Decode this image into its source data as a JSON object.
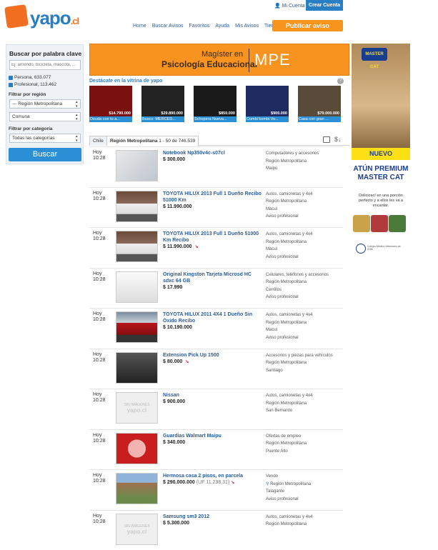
{
  "header": {
    "logo_text": "yapo",
    "logo_tld": ".cl",
    "mi_cuenta": "Mi Cuenta",
    "crear_cuenta": "Crear Cuenta",
    "nav": [
      "Home",
      "Buscar Avisos",
      "Favoritos",
      "Ayuda",
      "Mis Avisos",
      "Tiendas"
    ],
    "publicar": "Publicar aviso"
  },
  "sidebar": {
    "title": "Buscar por palabra clave",
    "search_placeholder": "Ej: arriendo, bicicleta, mascota, ...",
    "persona": "Persona, 633.077",
    "profesional": "Profesional, 113.462",
    "region_label": "Filtrar por región",
    "region_value": "--- Región Metropolitana",
    "comuna_value": "Comuna",
    "categoria_label": "Filtrar por categoría",
    "categoria_value": "Todas las categorías",
    "buscar": "Buscar"
  },
  "banner": {
    "line1": "Magíster en",
    "line2": "Psicología Educacional",
    "brand": "MPE"
  },
  "vitrina": {
    "title": "Destácate en la vitrina de yapo",
    "help": "?",
    "items": [
      {
        "price": "$14.790.000",
        "caption": "Deuda con tu a...",
        "color": "#7a1010"
      },
      {
        "price": "$29.890.000",
        "caption": "Busco: MERCED...",
        "color": "#222"
      },
      {
        "price": "$850.000",
        "caption": "Schopera Nueva...",
        "color": "#1a1a1a"
      },
      {
        "price": "$900.000",
        "caption": "Combi kombi Vo...",
        "color": "#1f2a60"
      },
      {
        "price": "$79.000.000",
        "caption": "Casa con gran ...",
        "color": "#5a4a3a"
      }
    ]
  },
  "tabs": {
    "chile": "Chile",
    "region": "Región Metropolitana",
    "count": "1 - 50 de 746.539"
  },
  "listings": [
    {
      "date": "Hoy",
      "time": "10:28",
      "title": "Notebook Np350v4c-s07cl",
      "price": "$ 300.000",
      "uf": "",
      "down": false,
      "meta": [
        "Computadores y accesorios",
        "Región Metropolitana",
        "Maipú"
      ],
      "thumb": "laptop",
      "pin": false
    },
    {
      "date": "Hoy",
      "time": "10:28",
      "title": "TOYOTA HILUX 2013 Full 1 Dueño Recibo 51000 Km",
      "price": "$ 11.990.000",
      "uf": "",
      "down": false,
      "meta": [
        "Autos, camionetas y 4x4",
        "Región Metropolitana",
        "Macul",
        "Aviso profesional"
      ],
      "thumb": "truck-white",
      "pin": false
    },
    {
      "date": "Hoy",
      "time": "10:28",
      "title": "TOYOTA HILUX 2013 Full 1 Dueño 51000 Km Recibo",
      "price": "$ 11.990.000",
      "uf": "",
      "down": true,
      "meta": [
        "Autos, camionetas y 4x4",
        "Región Metropolitana",
        "Macul",
        "Aviso profesional"
      ],
      "thumb": "truck-white",
      "pin": false
    },
    {
      "date": "Hoy",
      "time": "10:28",
      "title": "Original Kingston Tarjeta Microsd HC sdxc 64 GB",
      "price": "$ 17.990",
      "uf": "",
      "down": false,
      "meta": [
        "Celulares, teléfonos y accesorios",
        "Región Metropolitana",
        "Cerrillos",
        "Aviso profesional"
      ],
      "thumb": "card",
      "pin": false
    },
    {
      "date": "Hoy",
      "time": "10:28",
      "title": "TOYOTA HILUX 2011 4X4 1 Dueño Sin Oxido Recibo",
      "price": "$ 10.190.000",
      "uf": "",
      "down": false,
      "meta": [
        "Autos, camionetas y 4x4",
        "Región Metropolitana",
        "Macul",
        "Aviso profesional"
      ],
      "thumb": "truck-red",
      "pin": false
    },
    {
      "date": "Hoy",
      "time": "10:28",
      "title": "Extension Pick Up 1500",
      "price": "$ 80.000",
      "uf": "",
      "down": true,
      "meta": [
        "Accesorios y piezas para vehículos",
        "Región Metropolitana",
        "Santiago"
      ],
      "thumb": "pickup",
      "pin": false
    },
    {
      "date": "Hoy",
      "time": "10:28",
      "title": "Nissan",
      "price": "$ 900.000",
      "uf": "",
      "down": false,
      "meta": [
        "Autos, camionetas y 4x4",
        "Región Metropolitana",
        "San Bernardo"
      ],
      "thumb": "none",
      "pin": false
    },
    {
      "date": "Hoy",
      "time": "10:28",
      "title": "Guardias Walmart Maipu",
      "price": "$ 340.000",
      "uf": "",
      "down": false,
      "meta": [
        "Ofertas de empleo",
        "Región Metropolitana",
        "Puente Alto"
      ],
      "thumb": "guardias",
      "pin": false
    },
    {
      "date": "Hoy",
      "time": "10:28",
      "title": "Hermosa casa 2 pisos, en parcela",
      "price": "$ 290.000.000",
      "uf": "(UF 11.238,31)",
      "down": true,
      "meta": [
        "Vendo",
        "Región Metropolitana",
        "Talagante",
        "Aviso profesional"
      ],
      "thumb": "house",
      "pin": true
    },
    {
      "date": "Hoy",
      "time": "10:28",
      "title": "Samsung sm3 2012",
      "price": "$ 5.300.000",
      "uf": "",
      "down": false,
      "meta": [
        "Autos, camionetas y 4x4",
        "Región Metropolitana"
      ],
      "thumb": "none",
      "pin": false
    }
  ],
  "no_image": {
    "line1": "SIN IMÁGENES",
    "line2": "yapo.cl"
  },
  "right_ad": {
    "brand": "MASTER CAT",
    "nuevo": "NUEVO",
    "headline": "ATÚN PREMIUM MASTER CAT",
    "copy": "Delicioso! en una porción perfecto y a ellos les va a encantar.",
    "seal": "Colegio Médico Veterinario de Chile"
  }
}
